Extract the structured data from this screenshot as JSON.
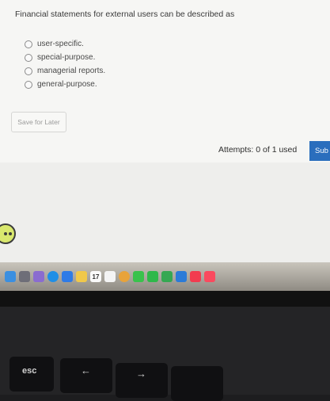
{
  "question": {
    "prompt": "Financial statements for external users can be described as",
    "options": [
      {
        "label": "user-specific."
      },
      {
        "label": "special-purpose."
      },
      {
        "label": "managerial reports."
      },
      {
        "label": "general-purpose."
      }
    ]
  },
  "actions": {
    "save_later_label": "Save for Later",
    "attempts_text": "Attempts: 0 of 1 used",
    "submit_label": "Sub"
  },
  "dock": {
    "calendar_day": "17",
    "icons": [
      "finder-icon",
      "launchpad-icon",
      "apps-grid-icon",
      "safari-icon",
      "mail-icon",
      "notes-icon",
      "calendar-icon",
      "reminders-icon",
      "photos-icon",
      "messages-icon",
      "facetime-icon",
      "numbers-icon",
      "keynote-icon",
      "news-icon",
      "music-icon"
    ]
  },
  "keyboard": {
    "esc_label": "esc",
    "back_arrow": "←",
    "forward_arrow": "→"
  },
  "colors": {
    "submit_blue": "#2a6ebd",
    "page_background": "#f6f6f4"
  }
}
